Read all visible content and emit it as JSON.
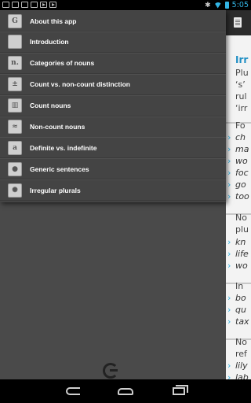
{
  "status_bar": {
    "time": "5:05",
    "bluetooth": "✱"
  },
  "content": {
    "title": "Irr",
    "lines": [
      {
        "kind": "text",
        "text": "Plu"
      },
      {
        "kind": "text",
        "text": "‘s’"
      },
      {
        "kind": "text",
        "text": "rul"
      },
      {
        "kind": "text",
        "text": "‘irr"
      },
      {
        "kind": "text",
        "text": "Fo"
      },
      {
        "kind": "item",
        "text": "ch"
      },
      {
        "kind": "item",
        "text": "ma"
      },
      {
        "kind": "item",
        "text": "wo"
      },
      {
        "kind": "item",
        "text": "foc"
      },
      {
        "kind": "item",
        "text": "go"
      },
      {
        "kind": "item",
        "text": "too"
      },
      {
        "kind": "text",
        "text": "No"
      },
      {
        "kind": "text",
        "text": "plu"
      },
      {
        "kind": "item",
        "text": "kn"
      },
      {
        "kind": "item",
        "text": "life"
      },
      {
        "kind": "item",
        "text": "wo"
      },
      {
        "kind": "text",
        "text": "In"
      },
      {
        "kind": "item",
        "text": "bo"
      },
      {
        "kind": "item",
        "text": "qu"
      },
      {
        "kind": "item",
        "text": "tax"
      },
      {
        "kind": "text",
        "text": "No"
      },
      {
        "kind": "text",
        "text": "ref"
      },
      {
        "kind": "item",
        "text": "lily"
      },
      {
        "kind": "item",
        "text": "lab"
      }
    ]
  },
  "drawer": {
    "items": [
      {
        "label": "About this app",
        "icon": "app-logo-icon",
        "glyph": "G"
      },
      {
        "label": "Introduction",
        "icon": "blank-page-icon",
        "glyph": ""
      },
      {
        "label": "Categories of nouns",
        "icon": "letter-n-icon",
        "glyph": "n."
      },
      {
        "label": "Count vs. non-count distinction",
        "icon": "count-noncount-icon",
        "glyph": "±"
      },
      {
        "label": "Count nouns",
        "icon": "books-icon",
        "glyph": "▥"
      },
      {
        "label": "Non-count nouns",
        "icon": "scribble-icon",
        "glyph": "≈"
      },
      {
        "label": "Definite vs. indefinite",
        "icon": "articles-icon",
        "glyph": "a"
      },
      {
        "label": "Generic sentences",
        "icon": "lightbulb-icon",
        "glyph": "●"
      },
      {
        "label": "Irregular plurals",
        "icon": "irregular-icon",
        "glyph": "✺"
      }
    ]
  }
}
